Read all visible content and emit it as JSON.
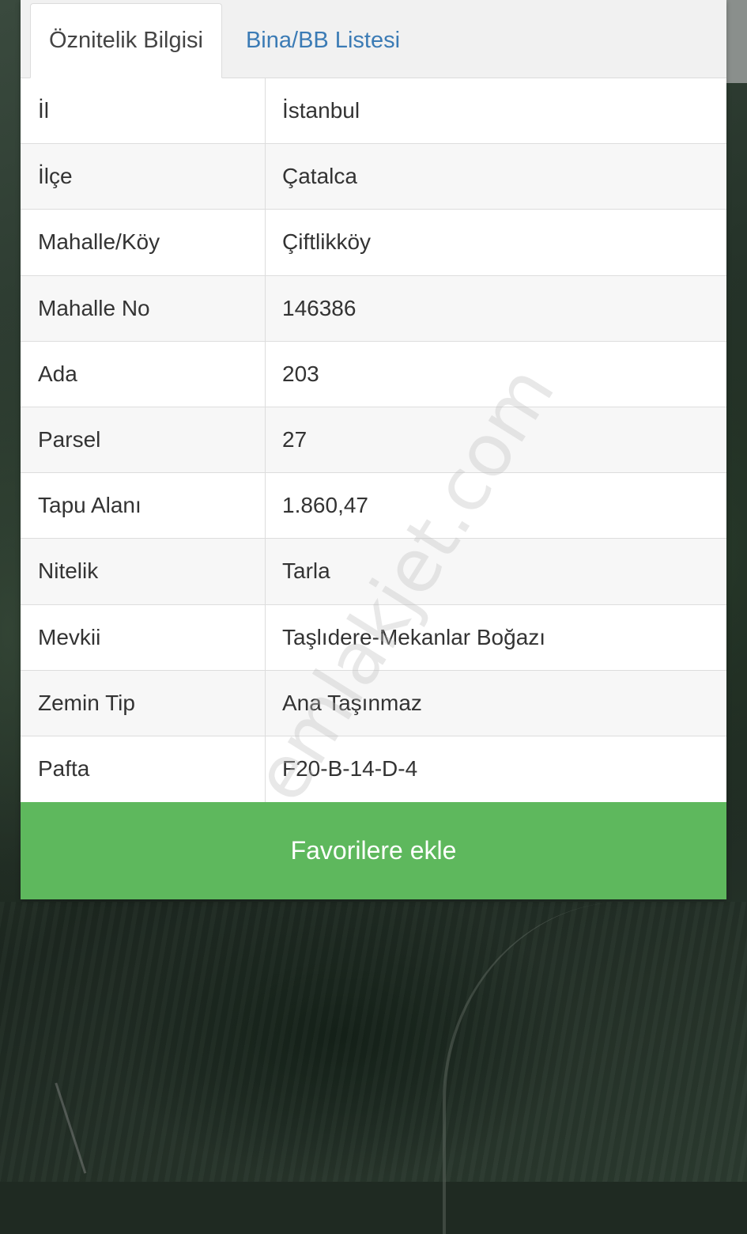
{
  "tabs": [
    {
      "label": "Öznitelik Bilgisi",
      "active": true
    },
    {
      "label": "Bina/BB Listesi",
      "active": false
    }
  ],
  "attributes": [
    {
      "label": "İl",
      "value": "İstanbul"
    },
    {
      "label": "İlçe",
      "value": "Çatalca"
    },
    {
      "label": "Mahalle/Köy",
      "value": "Çiftlikköy"
    },
    {
      "label": "Mahalle No",
      "value": "146386"
    },
    {
      "label": "Ada",
      "value": "203"
    },
    {
      "label": "Parsel",
      "value": "27"
    },
    {
      "label": "Tapu Alanı",
      "value": "1.860,47"
    },
    {
      "label": "Nitelik",
      "value": "Tarla"
    },
    {
      "label": "Mevkii",
      "value": "Taşlıdere-Mekanlar Boğazı"
    },
    {
      "label": "Zemin Tip",
      "value": "Ana Taşınmaz"
    },
    {
      "label": "Pafta",
      "value": "F20-B-14-D-4"
    }
  ],
  "favorite_button": {
    "label": "Favorilere ekle"
  },
  "watermark": "emlakjet.com",
  "colors": {
    "tab_link": "#3b7bb5",
    "button_green": "#5eb85d"
  }
}
